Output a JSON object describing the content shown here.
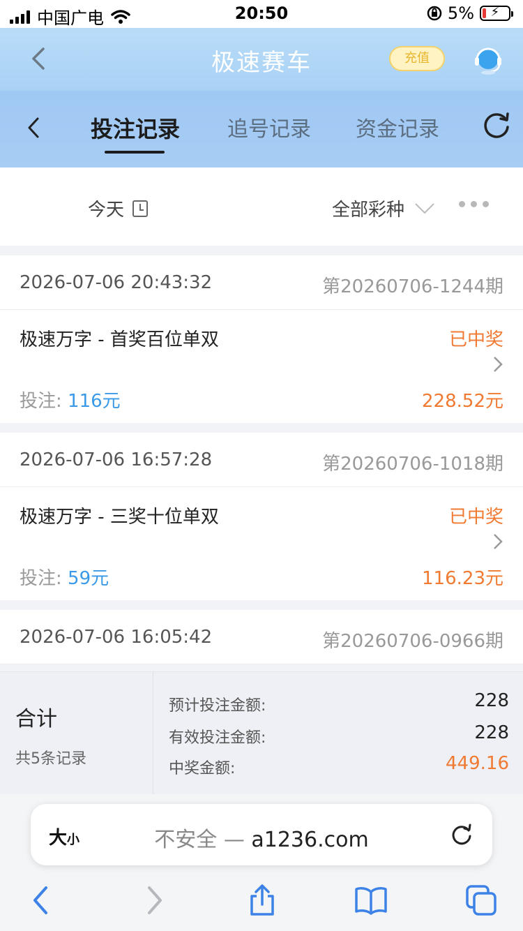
{
  "status_bar": {
    "carrier": "中国广电",
    "time": "20:50",
    "battery": "5%"
  },
  "nav": {
    "title": "极速赛车",
    "recharge": "充值"
  },
  "tabs": [
    {
      "label": "投注记录"
    },
    {
      "label": "追号记录"
    },
    {
      "label": "资金记录"
    }
  ],
  "filters": {
    "date": "今天",
    "lottery": "全部彩种"
  },
  "records": [
    {
      "time": "2026-07-06 20:43:32",
      "issue": "第20260706-1244期",
      "name": "极速万字 - 首奖百位单双",
      "status": "已中奖",
      "bet_label": "投注:",
      "bet": "116元",
      "amount": "228.52元"
    },
    {
      "time": "2026-07-06 16:57:28",
      "issue": "第20260706-1018期",
      "name": "极速万字 - 三奖十位单双",
      "status": "已中奖",
      "bet_label": "投注:",
      "bet": "59元",
      "amount": "116.23元"
    },
    {
      "time": "2026-07-06 16:05:42",
      "issue": "第20260706-0966期"
    }
  ],
  "summary": {
    "title": "合计",
    "count": "共5条记录",
    "rows": [
      {
        "label": "预计投注金额:",
        "value": "228"
      },
      {
        "label": "有效投注金额:",
        "value": "228"
      },
      {
        "label": "中奖金额:",
        "value": "449.16"
      }
    ]
  },
  "browser": {
    "aa": "大",
    "aa_small": "小",
    "insecure": "不安全 — ",
    "domain": "a1236.com"
  },
  "colors": {
    "accent_blue": "#3a9ae8",
    "win_orange": "#f07a32",
    "nav_blue": "#a9d2f5"
  }
}
